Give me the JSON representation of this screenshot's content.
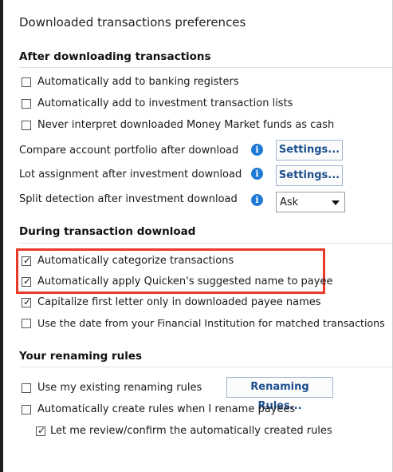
{
  "dialog": {
    "title": "Downloaded transactions preferences"
  },
  "after": {
    "heading": "After downloading transactions",
    "opt_add_banking": {
      "label": "Automatically add to banking registers",
      "checked": false
    },
    "opt_add_investment": {
      "label": "Automatically add to investment transaction lists",
      "checked": false
    },
    "opt_never_interpret": {
      "label": "Never interpret downloaded Money Market funds as cash",
      "checked": false
    },
    "compare_portfolio": {
      "label": "Compare account portfolio after download",
      "button": "Settings..."
    },
    "lot_assignment": {
      "label": "Lot assignment after investment download",
      "button": "Settings..."
    },
    "split_detection": {
      "label": "Split detection after investment download",
      "value": "Ask"
    }
  },
  "during": {
    "heading": "During transaction download",
    "opt_categorize": {
      "label": "Automatically categorize transactions",
      "checked": true
    },
    "opt_suggested_name": {
      "label": "Automatically apply Quicken's suggested name to payee",
      "checked": true
    },
    "opt_capitalize": {
      "label": "Capitalize first letter only in downloaded payee names",
      "checked": true
    },
    "opt_use_date": {
      "label": "Use the date from your Financial Institution for matched transactions",
      "checked": false
    }
  },
  "renaming": {
    "heading": "Your renaming rules",
    "opt_existing": {
      "label": "Use my existing renaming rules",
      "checked": false
    },
    "button": "Renaming Rules...",
    "opt_auto_create": {
      "label": "Automatically create rules when I rename payees",
      "checked": false
    },
    "opt_review": {
      "label": "Let me review/confirm the automatically created rules",
      "checked": true
    }
  },
  "icons": {
    "info": "info-icon",
    "check": "checkmark-icon",
    "dropdown": "chevron-down-icon"
  },
  "colors": {
    "highlight": "#e8392a",
    "info_blue": "#1f7ad6",
    "button_text": "#1b4f8f"
  }
}
